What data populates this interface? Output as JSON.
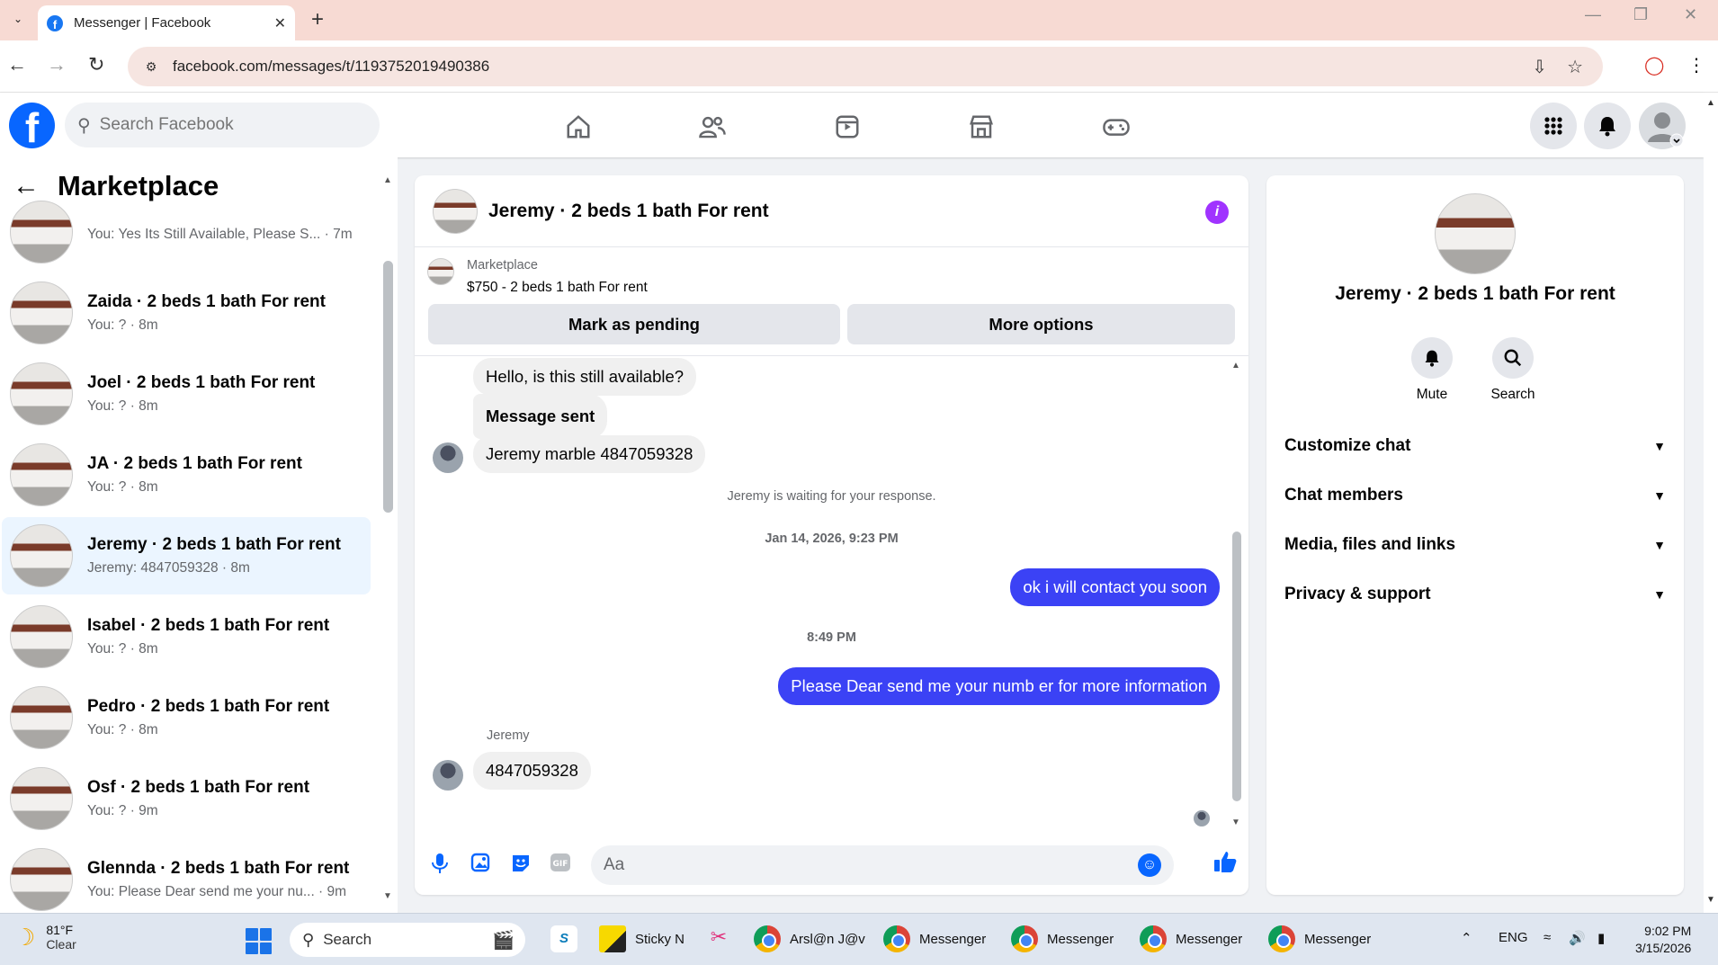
{
  "browser": {
    "tab_title": "Messenger | Facebook",
    "url": "facebook.com/messages/t/1193752019490386"
  },
  "fb_header": {
    "search_placeholder": "Search Facebook"
  },
  "left_panel": {
    "title": "Marketplace",
    "conversations": [
      {
        "name": "",
        "preview": "You: Yes Its Still Available, Please S... · 7m",
        "active": false
      },
      {
        "name": "Zaida · 2 beds 1 bath For rent",
        "preview": "You: ? · 8m",
        "active": false
      },
      {
        "name": "Joel · 2 beds 1 bath For rent",
        "preview": "You: ? · 8m",
        "active": false
      },
      {
        "name": "JA · 2 beds 1 bath For rent",
        "preview": "You: ? · 8m",
        "active": false
      },
      {
        "name": "Jeremy · 2 beds 1 bath For rent",
        "preview": "Jeremy: 4847059328 · 8m",
        "active": true
      },
      {
        "name": "Isabel · 2 beds 1 bath For rent",
        "preview": "You: ? · 8m",
        "active": false
      },
      {
        "name": "Pedro · 2 beds 1 bath For rent",
        "preview": "You: ? · 8m",
        "active": false
      },
      {
        "name": "Osf · 2 beds 1 bath For rent",
        "preview": "You: ? · 9m",
        "active": false
      },
      {
        "name": "Glennda · 2 beds 1 bath For rent",
        "preview": "You: Please Dear send me your nu... · 9m",
        "active": false
      }
    ]
  },
  "chat": {
    "title": "Jeremy · 2 beds 1 bath For rent",
    "marketplace_label": "Marketplace",
    "listing": "$750 - 2 beds 1 bath For rent",
    "mark_pending_label": "Mark as pending",
    "more_options_label": "More options",
    "messages": {
      "m1": "Hello, is this still available?",
      "m2": "Message sent",
      "m3": "Jeremy marble 4847059328",
      "waiting": "Jeremy is waiting for your response.",
      "date1": "Jan 14, 2026, 9:23 PM",
      "m4": "ok i will contact you soon",
      "time2": "8:49 PM",
      "m5": "Please Dear send me your numb er for more information",
      "sender": "Jeremy",
      "m6": "4847059328"
    },
    "composer_placeholder": "Aa"
  },
  "info_panel": {
    "name": "Jeremy · 2 beds 1 bath For rent",
    "mute_label": "Mute",
    "search_label": "Search",
    "sections": [
      "Customize chat",
      "Chat members",
      "Media, files and links",
      "Privacy & support"
    ]
  },
  "taskbar": {
    "temp": "81°F",
    "weather": "Clear",
    "search_label": "Search",
    "sticky": "Sticky N",
    "app1": "Arsl@n J@v",
    "messenger": "Messenger",
    "lang": "ENG",
    "time": "9:02 PM",
    "date": "3/15/2026"
  }
}
